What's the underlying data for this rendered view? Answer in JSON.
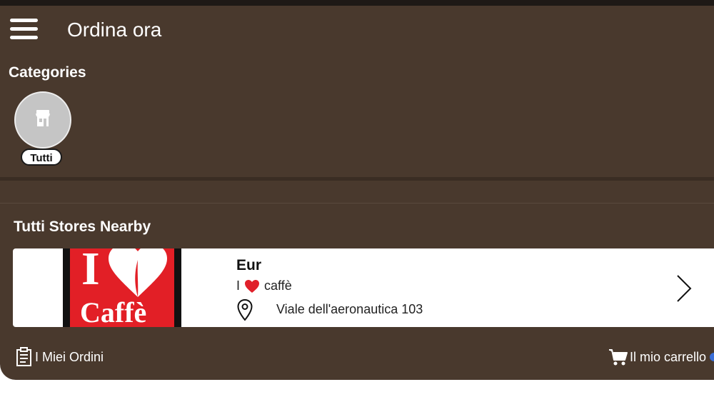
{
  "header": {
    "title": "Ordina ora",
    "menu_icon": "hamburger-menu-icon"
  },
  "categories": {
    "heading": "Categories",
    "items": [
      {
        "label": "Tutti",
        "icon": "store-icon"
      }
    ]
  },
  "stores": {
    "heading": "Tutti Stores Nearby",
    "items": [
      {
        "name": "Eur",
        "brand_prefix": "I",
        "brand_heart": "❤",
        "brand_suffix": "caffè",
        "address": "Viale dell'aeronautica 103",
        "logo_text_top": "I",
        "logo_text_bottom": "Caffè",
        "logo_colors": {
          "red": "#e21f26",
          "black": "#111111"
        }
      }
    ]
  },
  "bottom_nav": {
    "orders_label": "I Miei Ordini",
    "cart_label": "Il mio carrello",
    "orders_icon": "clipboard-icon",
    "cart_icon": "cart-icon"
  },
  "colors": {
    "background": "#49392d",
    "text": "#ffffff",
    "card": "#ffffff"
  }
}
